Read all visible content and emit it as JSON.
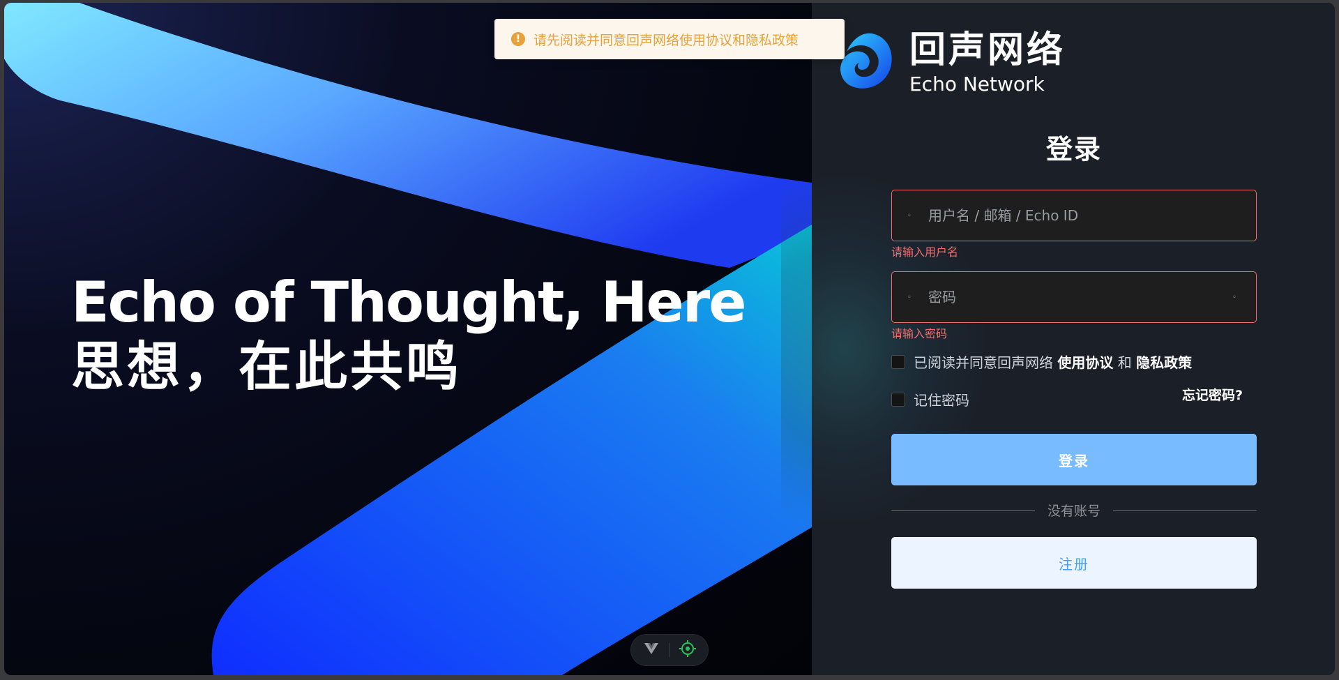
{
  "toast": {
    "icon": "warning-icon",
    "message": "请先阅读并同意回声网络使用协议和隐私政策",
    "color": "#e6a23c"
  },
  "hero": {
    "headline_en": "Echo of Thought, Here",
    "headline_cn": "思想，在此共鸣"
  },
  "brand": {
    "name_cn": "回声网络",
    "name_en": "Echo Network",
    "logo": "echo-logo"
  },
  "login": {
    "title": "登录",
    "username": {
      "placeholder": "用户名 / 邮箱 / Echo ID",
      "value": "",
      "error": "请输入用户名",
      "icon": "user-icon"
    },
    "password": {
      "placeholder": "密码",
      "value": "",
      "error": "请输入密码",
      "icon": "lock-icon",
      "toggle_icon": "eye-icon"
    },
    "agree": {
      "prefix": "已阅读并同意回声网络",
      "terms": "使用协议",
      "and": "和",
      "privacy": "隐私政策",
      "checked": false
    },
    "remember": {
      "label": "记住密码",
      "checked": false
    },
    "forgot": "忘记密码?",
    "submit_label": "登录",
    "divider_text": "没有账号",
    "register_label": "注册"
  },
  "devtools": {
    "icons": [
      "vue-devtools-icon",
      "inspector-target-icon"
    ]
  },
  "colors": {
    "error": "#f56c6c",
    "primary_light": "#79bbff",
    "primary": "#409eff",
    "panel_bg": "#1b1f27"
  }
}
